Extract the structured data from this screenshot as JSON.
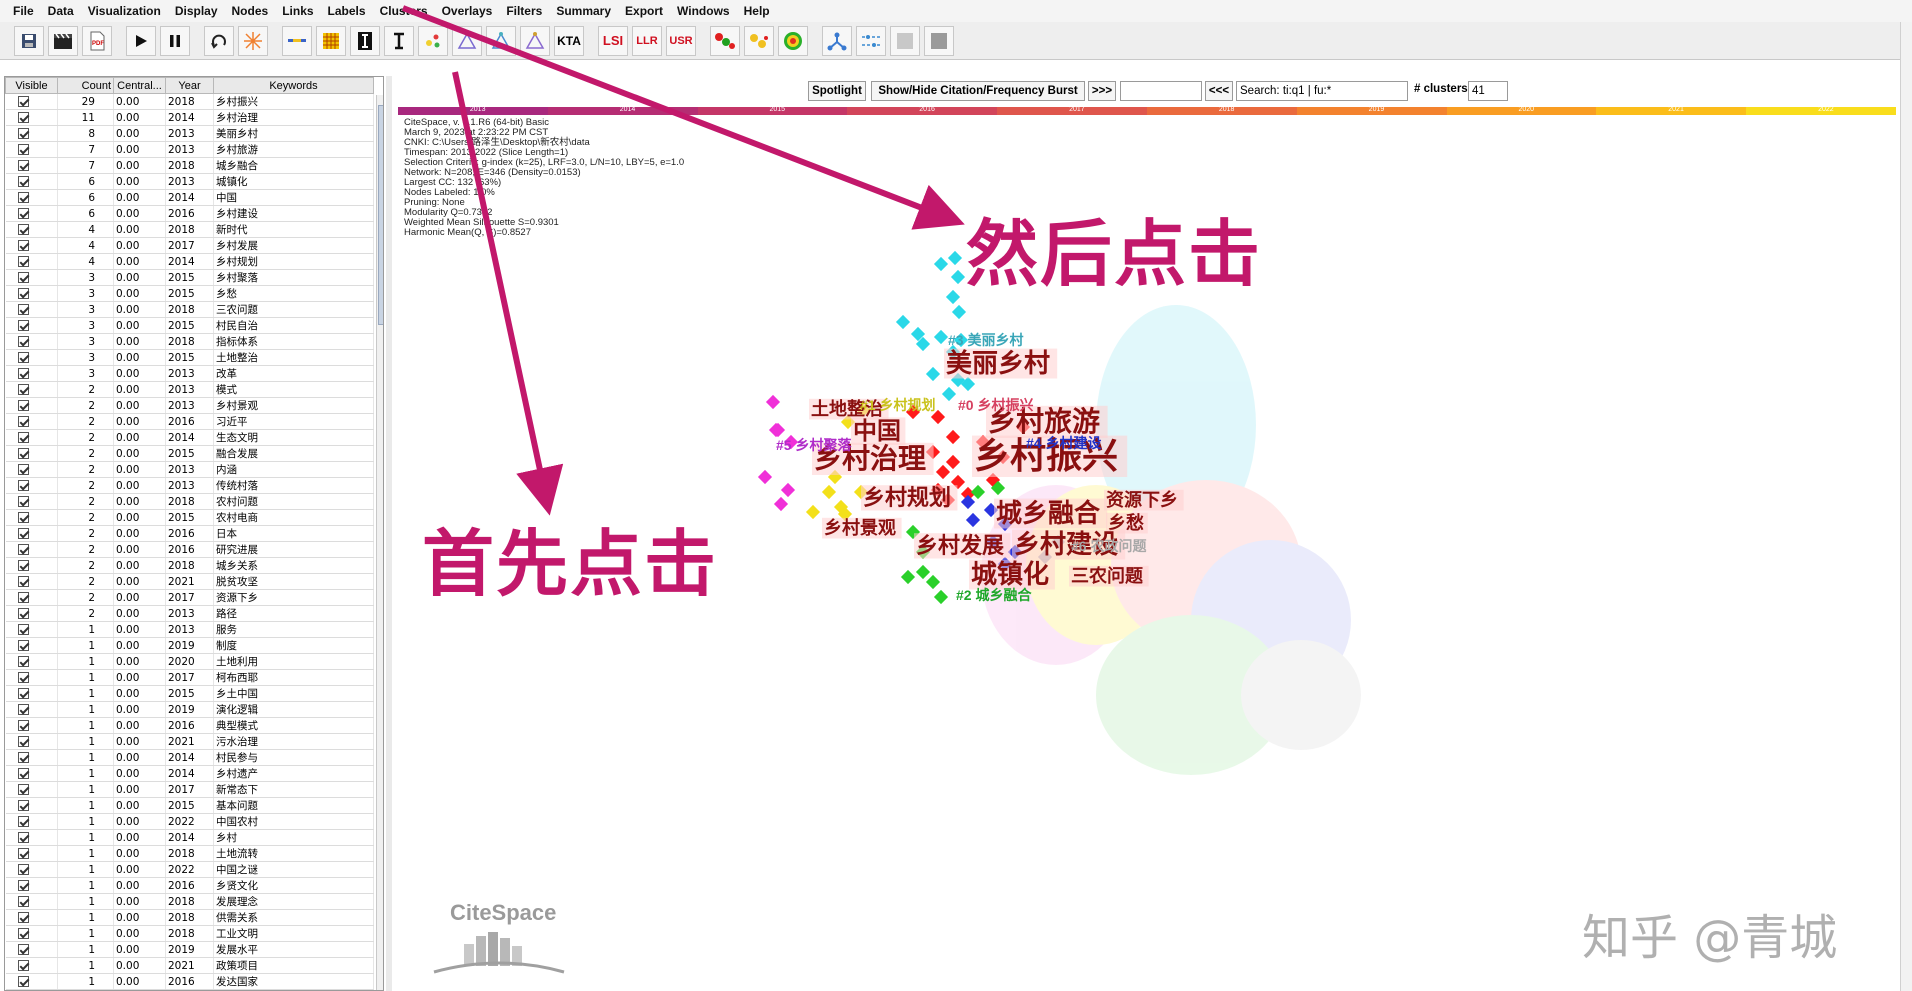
{
  "menu": [
    "File",
    "Data",
    "Visualization",
    "Display",
    "Nodes",
    "Links",
    "Labels",
    "Clusters",
    "Overlays",
    "Filters",
    "Summary",
    "Export",
    "Windows",
    "Help"
  ],
  "toolbar": {
    "icons": [
      "save-icon",
      "clapperboard-icon",
      "pdf-icon",
      "play-icon",
      "pause-icon",
      "rotate-icon",
      "burst-icon",
      "line-icon",
      "color-grid-icon",
      "text-bold-icon",
      "text-cursor-icon",
      "cluster-node-icon",
      "triangle-icon",
      "triangle-icon",
      "triangle-icon"
    ],
    "kta_label": "KTA",
    "lsi_label": "LSI",
    "llr_label": "LLR",
    "usr_label": "USR"
  },
  "table": {
    "headers": {
      "visible": "Visible",
      "count": "Count",
      "central": "Central...",
      "year": "Year",
      "keywords": "Keywords"
    },
    "rows": [
      [
        "29",
        "0.00",
        "2018",
        "乡村振兴"
      ],
      [
        "11",
        "0.00",
        "2014",
        "乡村治理"
      ],
      [
        "8",
        "0.00",
        "2013",
        "美丽乡村"
      ],
      [
        "7",
        "0.00",
        "2013",
        "乡村旅游"
      ],
      [
        "7",
        "0.00",
        "2018",
        "城乡融合"
      ],
      [
        "6",
        "0.00",
        "2013",
        "城镇化"
      ],
      [
        "6",
        "0.00",
        "2014",
        "中国"
      ],
      [
        "6",
        "0.00",
        "2016",
        "乡村建设"
      ],
      [
        "4",
        "0.00",
        "2018",
        "新时代"
      ],
      [
        "4",
        "0.00",
        "2017",
        "乡村发展"
      ],
      [
        "4",
        "0.00",
        "2014",
        "乡村规划"
      ],
      [
        "3",
        "0.00",
        "2015",
        "乡村聚落"
      ],
      [
        "3",
        "0.00",
        "2015",
        "乡愁"
      ],
      [
        "3",
        "0.00",
        "2018",
        "三农问题"
      ],
      [
        "3",
        "0.00",
        "2015",
        "村民自治"
      ],
      [
        "3",
        "0.00",
        "2018",
        "指标体系"
      ],
      [
        "3",
        "0.00",
        "2015",
        "土地整治"
      ],
      [
        "3",
        "0.00",
        "2013",
        "改革"
      ],
      [
        "2",
        "0.00",
        "2013",
        "模式"
      ],
      [
        "2",
        "0.00",
        "2013",
        "乡村景观"
      ],
      [
        "2",
        "0.00",
        "2016",
        "习近平"
      ],
      [
        "2",
        "0.00",
        "2014",
        "生态文明"
      ],
      [
        "2",
        "0.00",
        "2015",
        "融合发展"
      ],
      [
        "2",
        "0.00",
        "2013",
        "内涵"
      ],
      [
        "2",
        "0.00",
        "2013",
        "传统村落"
      ],
      [
        "2",
        "0.00",
        "2018",
        "农村问题"
      ],
      [
        "2",
        "0.00",
        "2015",
        "农村电商"
      ],
      [
        "2",
        "0.00",
        "2016",
        "日本"
      ],
      [
        "2",
        "0.00",
        "2016",
        "研究进展"
      ],
      [
        "2",
        "0.00",
        "2018",
        "城乡关系"
      ],
      [
        "2",
        "0.00",
        "2021",
        "脱贫攻坚"
      ],
      [
        "2",
        "0.00",
        "2017",
        "资源下乡"
      ],
      [
        "2",
        "0.00",
        "2013",
        "路径"
      ],
      [
        "1",
        "0.00",
        "2013",
        "服务"
      ],
      [
        "1",
        "0.00",
        "2019",
        "制度"
      ],
      [
        "1",
        "0.00",
        "2020",
        "土地利用"
      ],
      [
        "1",
        "0.00",
        "2017",
        "柯布西耶"
      ],
      [
        "1",
        "0.00",
        "2015",
        "乡土中国"
      ],
      [
        "1",
        "0.00",
        "2019",
        "演化逻辑"
      ],
      [
        "1",
        "0.00",
        "2016",
        "典型模式"
      ],
      [
        "1",
        "0.00",
        "2021",
        "污水治理"
      ],
      [
        "1",
        "0.00",
        "2014",
        "村民参与"
      ],
      [
        "1",
        "0.00",
        "2014",
        "乡村遗产"
      ],
      [
        "1",
        "0.00",
        "2017",
        "新常态下"
      ],
      [
        "1",
        "0.00",
        "2015",
        "基本问题"
      ],
      [
        "1",
        "0.00",
        "2022",
        "中国农村"
      ],
      [
        "1",
        "0.00",
        "2014",
        "乡村"
      ],
      [
        "1",
        "0.00",
        "2018",
        "土地流转"
      ],
      [
        "1",
        "0.00",
        "2022",
        "中国之谜"
      ],
      [
        "1",
        "0.00",
        "2016",
        "乡贤文化"
      ],
      [
        "1",
        "0.00",
        "2018",
        "发展理念"
      ],
      [
        "1",
        "0.00",
        "2018",
        "供需关系"
      ],
      [
        "1",
        "0.00",
        "2018",
        "工业文明"
      ],
      [
        "1",
        "0.00",
        "2019",
        "发展水平"
      ],
      [
        "1",
        "0.00",
        "2021",
        "政策项目"
      ],
      [
        "1",
        "0.00",
        "2016",
        "发达国家"
      ]
    ]
  },
  "topbar": {
    "spotlight": "Spotlight",
    "show_hide": "Show/Hide Citation/Frequency Burst",
    "forward": ">>>",
    "back": "<<<",
    "search_value": "Search: ti:q1 | fu:*",
    "clusters_label": "# clusters",
    "clusters_value": "41"
  },
  "timeline": {
    "years": [
      "2013",
      "2014",
      "2015",
      "2016",
      "2017",
      "2018",
      "2019",
      "2020",
      "2021",
      "2022"
    ],
    "colors": [
      "#a8287e",
      "#b52d73",
      "#c43667",
      "#d2455a",
      "#df564c",
      "#ea6a3d",
      "#f3822e",
      "#f99d22",
      "#fbbd1a",
      "#f9dd1c"
    ]
  },
  "info_lines": [
    "CiteSpace, v. 6.1.R6 (64-bit) Basic",
    "March 9, 2023 at 2:23:22 PM CST",
    "CNKI: C:\\Users\\路泽生\\Desktop\\新农村\\data",
    "Timespan: 2013-2022 (Slice Length=1)",
    "Selection Criteria: g-index (k=25), LRF=3.0, L/N=10, LBY=5, e=1.0",
    "Network: N=208, E=346 (Density=0.0153)",
    "Largest CC: 132 (63%)",
    "Nodes Labeled: 1.0%",
    "Pruning: None",
    "Modularity Q=0.7372",
    "Weighted Mean Silhouette S=0.9301",
    "Harmonic Mean(Q, S)=0.8527"
  ],
  "node_labels": [
    {
      "text": "美丽乡村",
      "size": 26
    },
    {
      "text": "土地整治",
      "size": 18
    },
    {
      "text": "中国",
      "size": 24
    },
    {
      "text": "乡村旅游",
      "size": 28
    },
    {
      "text": "乡村治理",
      "size": 28
    },
    {
      "text": "乡村振兴",
      "size": 36
    },
    {
      "text": "乡村规划",
      "size": 22
    },
    {
      "text": "资源下乡",
      "size": 18
    },
    {
      "text": "乡愁",
      "size": 18
    },
    {
      "text": "城乡融合",
      "size": 26
    },
    {
      "text": "乡村景观",
      "size": 18
    },
    {
      "text": "乡村发展",
      "size": 22
    },
    {
      "text": "乡村建设",
      "size": 26
    },
    {
      "text": "城镇化",
      "size": 26
    },
    {
      "text": "三农问题",
      "size": 18
    }
  ],
  "cluster_labels": [
    {
      "text": "#3 美丽乡村",
      "color": "#3aa6b8"
    },
    {
      "text": "#1 乡村规划",
      "color": "#c9c21c"
    },
    {
      "text": "#0 乡村振兴",
      "color": "#d64060"
    },
    {
      "text": "#5 乡村聚落",
      "color": "#b02cc9"
    },
    {
      "text": "#4 乡村建设",
      "color": "#2233c8"
    },
    {
      "text": "#6 农政问题",
      "color": "#a8a8a8"
    },
    {
      "text": "#2 城乡融合",
      "color": "#1fa82a"
    }
  ],
  "annotations": {
    "first": "首先点击",
    "then": "然后点击"
  },
  "logo": "CiteSpace",
  "watermark": "知乎 @青城"
}
